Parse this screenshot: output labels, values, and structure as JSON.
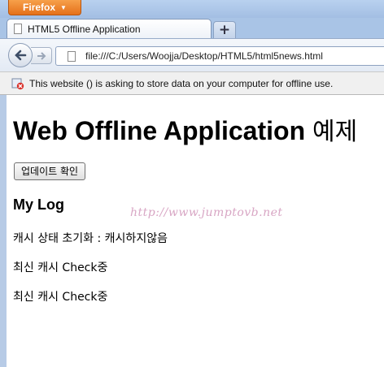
{
  "browser": {
    "menu_button_label": "Firefox",
    "tab_title": "HTML5 Offline Application",
    "new_tab_label": "+",
    "url": "file:///C:/Users/Woojja/Desktop/HTML5/html5news.html",
    "notification": "This website () is asking to store data on your computer for offline use."
  },
  "page": {
    "title": "Web Offline Application",
    "title_suffix": "예제",
    "update_button_label": "업데이트 확인",
    "log_heading": "My Log",
    "watermark": "http://www.jumptovb.net",
    "log_lines": [
      "캐시 상태 초기화 : 캐시하지않음",
      "최신 캐시 Check중",
      "최신 캐시 Check중"
    ]
  },
  "icons": {
    "back": "back-arrow-icon",
    "forward": "forward-arrow-icon",
    "page": "page-icon",
    "notification": "storage-warning-icon"
  },
  "colors": {
    "firefox_orange": "#e5701a",
    "chrome_blue": "#a9c4e6"
  }
}
